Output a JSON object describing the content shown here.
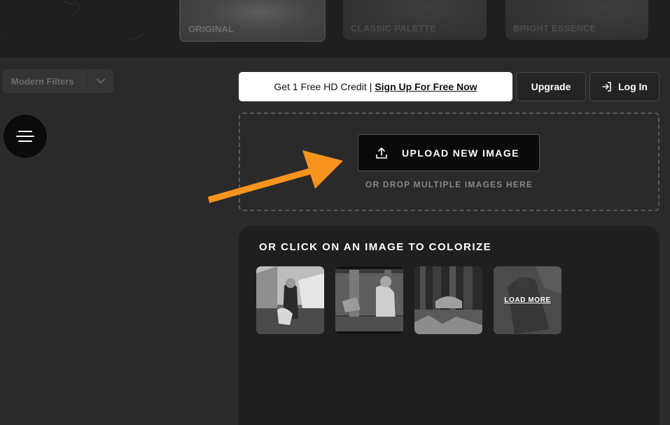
{
  "filters": {
    "items": [
      {
        "label": "ORIGINAL"
      },
      {
        "label": "CLASSIC PALETTE"
      },
      {
        "label": "BRIGHT ESSENCE"
      }
    ]
  },
  "sidebar": {
    "filter_select_value": "Modern Filters",
    "menu_icon": "hamburger-icon"
  },
  "header": {
    "promo_text": "Get 1 Free HD Credit",
    "promo_separator": "|",
    "promo_link": "Sign Up For Free Now",
    "upgrade_label": "Upgrade",
    "login_label": "Log In",
    "login_icon": "log-in-icon"
  },
  "upload": {
    "button_label": "UPLOAD NEW IMAGE",
    "button_icon": "upload-icon",
    "drop_hint": "OR DROP MULTIPLE IMAGES HERE",
    "annotation_color": "#f7941d"
  },
  "samples": {
    "title": "OR CLICK ON AN IMAGE TO COLORIZE",
    "load_more_label": "LOAD MORE"
  }
}
